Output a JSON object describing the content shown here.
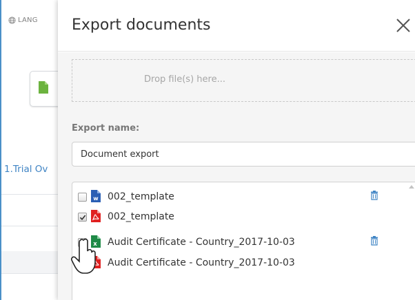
{
  "background": {
    "language_label": "LANG",
    "link_text": "1.Trial Ov",
    "icons": {
      "language": "globe-icon",
      "file": "document-icon"
    }
  },
  "dialog": {
    "title": "Export documents",
    "close_icon": "close-icon",
    "dropzone_text": "Drop file(s) here...",
    "export_name_label": "Export name:",
    "export_name_value": "Document export",
    "files": [
      {
        "checked": false,
        "type": "word",
        "icon": "word-icon",
        "name": "002_template",
        "deletable": true
      },
      {
        "checked": true,
        "type": "pdf",
        "icon": "pdf-icon",
        "name": "002_template",
        "deletable": false
      },
      {
        "checked": false,
        "type": "excel",
        "icon": "excel-icon",
        "name": "Audit Certificate - Country_2017-10-03",
        "deletable": true
      },
      {
        "checked": true,
        "type": "pdf",
        "icon": "pdf-icon",
        "name": "Audit Certificate - Country_2017-10-03",
        "deletable": false
      }
    ]
  },
  "colors": {
    "word": "#2b5fb4",
    "pdf": "#e02020",
    "excel": "#1f8a47",
    "accent": "#3f84c4",
    "file_card_icon": "#6cb33f"
  }
}
